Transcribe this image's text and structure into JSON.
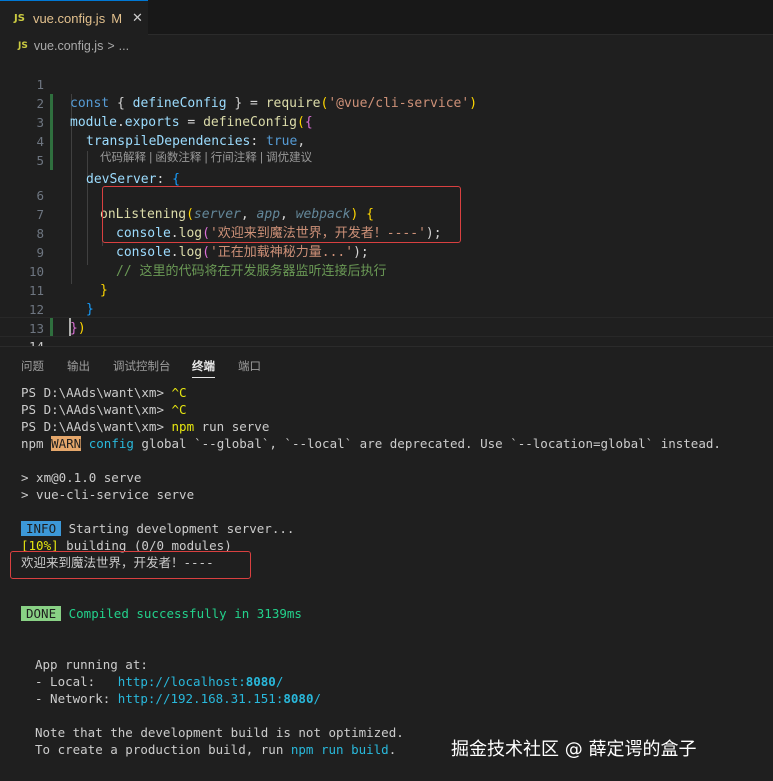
{
  "tab": {
    "icon": "JS",
    "filename": "vue.config.js",
    "modified": "M",
    "close": "✕"
  },
  "breadcrumb": {
    "icon": "JS",
    "file": "vue.config.js",
    "separator": ">",
    "more": "..."
  },
  "editor": {
    "line_numbers": [
      "1",
      "2",
      "3",
      "4",
      "5",
      "6",
      "7",
      "8",
      "9",
      "10",
      "11",
      "12",
      "13",
      "14"
    ],
    "codelens": "代码解释 | 函数注释 | 行间注释 | 调优建议",
    "code": {
      "l1": [
        "const",
        " { ",
        "defineConfig",
        " } = ",
        "require",
        "(",
        "'@vue/cli-service'",
        ")"
      ],
      "l2": [
        "module",
        ".",
        "exports",
        " = ",
        "defineConfig",
        "(",
        "{"
      ],
      "l3": [
        "transpileDependencies",
        ": ",
        "true",
        ","
      ],
      "l5": [
        "devServer",
        ": ",
        "{"
      ],
      "l6": [
        "onListening",
        "(",
        "server",
        ", ",
        "app",
        ", ",
        "webpack",
        ") ",
        "{"
      ],
      "l7": [
        "console",
        ".",
        "log",
        "(",
        "'欢迎来到魔法世界，开发者！----'",
        ");"
      ],
      "l8": [
        "console",
        ".",
        "log",
        "(",
        "'正在加载神秘力量...'",
        ");"
      ],
      "l9": "// 这里的代码将在开发服务器监听连接后执行",
      "l10": "}",
      "l11": "}",
      "l12": [
        "}",
        ")"
      ]
    }
  },
  "panel": {
    "tabs": [
      "问题",
      "输出",
      "调试控制台",
      "终端",
      "端口"
    ],
    "active_tab": "终端"
  },
  "terminal": {
    "l1_prompt": "PS D:\\AAds\\want\\xm> ",
    "l1_cmd": "^C",
    "l2_prompt": "PS D:\\AAds\\want\\xm> ",
    "l2_cmd": "^C",
    "l3_prompt": "PS D:\\AAds\\want\\xm> ",
    "l3_cmd": "npm",
    "l3_args": " run serve",
    "l4_a": "npm ",
    "l4_warn": "WARN",
    "l4_b": " config",
    "l4_c": " global `--global`, `--local` are deprecated. Use `--location=global` instead.",
    "l5": "> xm@0.1.0 serve",
    "l6": "> vue-cli-service serve",
    "l7_badge": "INFO",
    "l7_text": " Starting development server...",
    "l8_pct": "[10%]",
    "l8_text": " building (0/0 modules)",
    "l9": "欢迎来到魔法世界，开发者！----",
    "l10_badge": "DONE",
    "l10_text": " Compiled successfully in 3139ms",
    "l11": "App running at:",
    "l12_label": "- Local:   ",
    "l12_url_a": "http://localhost:",
    "l12_port": "8080",
    "l12_url_b": "/",
    "l13_label": "- Network: ",
    "l13_url_a": "http://192.168.31.151:",
    "l13_port": "8080",
    "l13_url_b": "/",
    "l14": "Note that the development build is not optimized.",
    "l15_a": "To create a production build, run ",
    "l15_cmd": "npm run build",
    "l15_b": "."
  },
  "watermark": "掘金技术社区 @ 薛定谔的盒子",
  "colors": {
    "accent": "#0078d4",
    "highlight_box": "#d94040",
    "warn": "#e5a76b",
    "info": "#3c98d8",
    "done": "#89d185"
  }
}
